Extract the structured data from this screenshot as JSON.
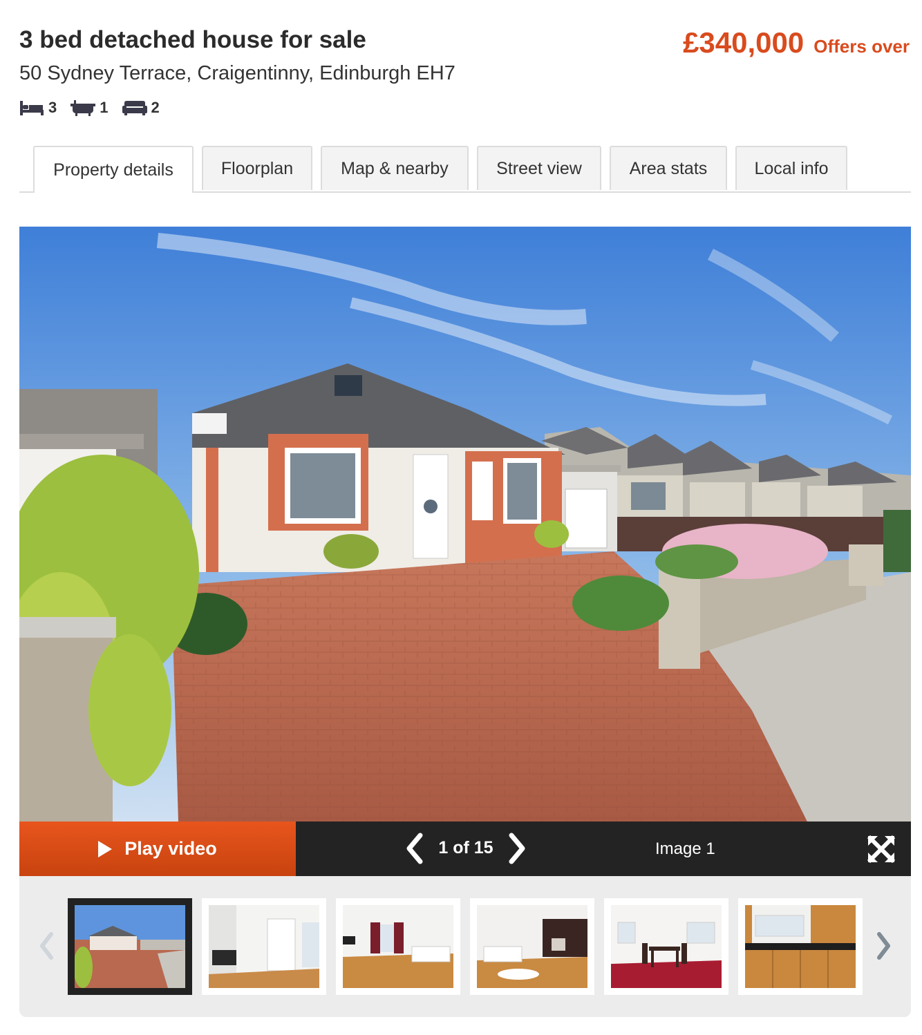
{
  "listing": {
    "title": "3 bed detached house for sale",
    "address": "50 Sydney Terrace, Craigentinny, Edinburgh EH7",
    "price": "£340,000",
    "price_qualifier": "Offers over",
    "features": [
      {
        "icon": "bed-icon",
        "count": "3"
      },
      {
        "icon": "bath-icon",
        "count": "1"
      },
      {
        "icon": "sofa-icon",
        "count": "2"
      }
    ]
  },
  "tabs": [
    {
      "label": "Property details",
      "active": true
    },
    {
      "label": "Floorplan"
    },
    {
      "label": "Map & nearby"
    },
    {
      "label": "Street view"
    },
    {
      "label": "Area stats"
    },
    {
      "label": "Local info"
    }
  ],
  "gallery": {
    "play_video_label": "Play video",
    "counter": "1 of 15",
    "image_label": "Image 1",
    "thumbnails": [
      {
        "subject": "house exterior",
        "active": true
      },
      {
        "subject": "hallway"
      },
      {
        "subject": "living room"
      },
      {
        "subject": "lounge"
      },
      {
        "subject": "dining room"
      },
      {
        "subject": "kitchen"
      }
    ]
  },
  "colors": {
    "accent": "#d94b1e",
    "play_button": "#e8551d",
    "control_bar": "#232323",
    "strip_background": "#ececec"
  }
}
